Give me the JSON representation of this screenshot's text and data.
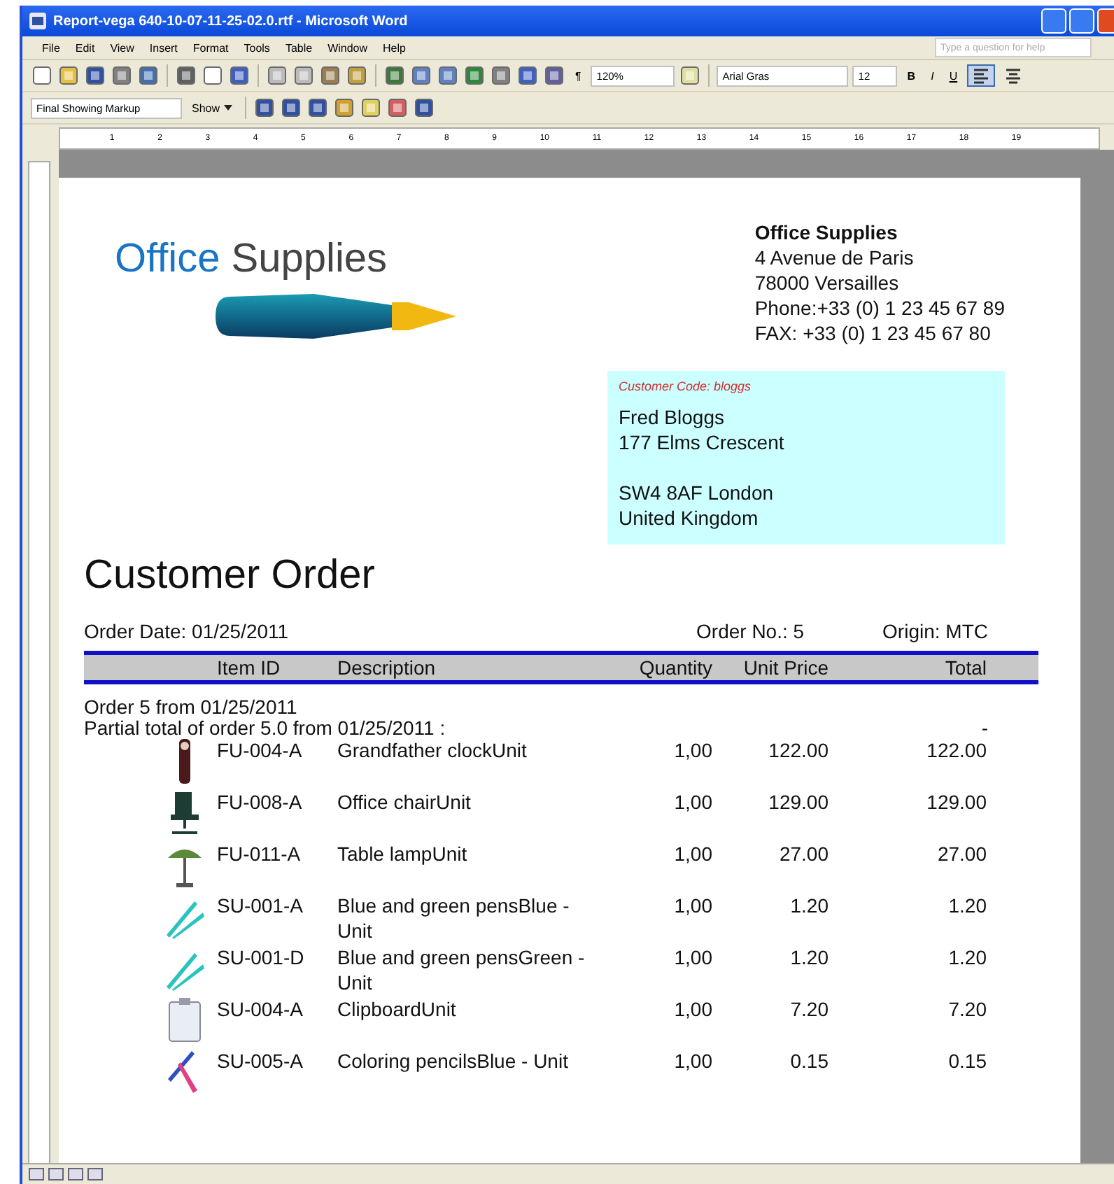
{
  "window": {
    "title": "Report-vega 640-10-07-11-25-02.0.rtf - Microsoft Word"
  },
  "menu_bar": [
    "File",
    "Edit",
    "View",
    "Insert",
    "Format",
    "Tools",
    "Table",
    "Window",
    "Help"
  ],
  "help_box": {
    "placeholder": "Type a question for help"
  },
  "standard_toolbar": {
    "pilcrow": "¶",
    "zoom": "120%"
  },
  "formatting_toolbar": {
    "font": "Arial Gras",
    "size": "12",
    "styles": [
      "B",
      "I",
      "U"
    ],
    "alignments": [
      {
        "selected": true
      },
      {
        "selected": false
      }
    ]
  },
  "reviewing_toolbar": {
    "display": "Final Showing Markup",
    "show": "Show"
  },
  "ruler": [
    "1",
    "2",
    "3",
    "4",
    "5",
    "6",
    "7",
    "8",
    "9",
    "10",
    "11",
    "12",
    "13",
    "14",
    "15",
    "16",
    "17",
    "18",
    "19"
  ],
  "document": {
    "logo": {
      "word_1": "Office",
      "word_2": "Supplies"
    },
    "sender": {
      "name": "Office Supplies",
      "lines": [
        "4 Avenue de Paris",
        "78000 Versailles",
        "Phone:+33 (0) 1 23 45 67 89",
        "FAX:   +33 (0) 1 23 45 67 80"
      ]
    },
    "customer": {
      "code": "Customer Code:  bloggs",
      "lines": [
        "Fred Bloggs",
        "177 Elms Crescent"
      ],
      "lines_2": [
        "SW4 8AF London",
        "United Kingdom"
      ]
    },
    "heading": "Customer Order",
    "order_date": "Order Date: 01/25/2011",
    "order_no": "Order No.:  5",
    "origin": "Origin: MTC",
    "columns": [
      "Item ID",
      "Description",
      "Quantity",
      "Unit Price",
      "Total"
    ],
    "group_title": "Order 5 from 01/25/2011",
    "partial_total": "Partial total of order 5.0 from 01/25/2011 :",
    "partial_total_value": "-",
    "rows": [
      {
        "item_id": "FU-004-A",
        "description": "Grandfather clockUnit",
        "quantity": "1,00",
        "unit_price": "122.00",
        "total": "122.00"
      },
      {
        "item_id": "FU-008-A",
        "description": "Office chairUnit",
        "quantity": "1,00",
        "unit_price": "129.00",
        "total": "129.00"
      },
      {
        "item_id": "FU-011-A",
        "description": "Table lampUnit",
        "quantity": "1,00",
        "unit_price": "27.00",
        "total": "27.00"
      },
      {
        "item_id": "SU-001-A",
        "description": "Blue and green pensBlue - Unit",
        "quantity": "1,00",
        "unit_price": "1.20",
        "total": "1.20"
      },
      {
        "item_id": "SU-001-D",
        "description": "Blue and green pensGreen - Unit",
        "quantity": "1,00",
        "unit_price": "1.20",
        "total": "1.20"
      },
      {
        "item_id": "SU-004-A",
        "description": "ClipboardUnit",
        "quantity": "1,00",
        "unit_price": "7.20",
        "total": "7.20"
      },
      {
        "item_id": "SU-005-A",
        "description": "Coloring pencilsBlue - Unit",
        "quantity": "1,00",
        "unit_price": "0.15",
        "total": "0.15"
      }
    ]
  }
}
